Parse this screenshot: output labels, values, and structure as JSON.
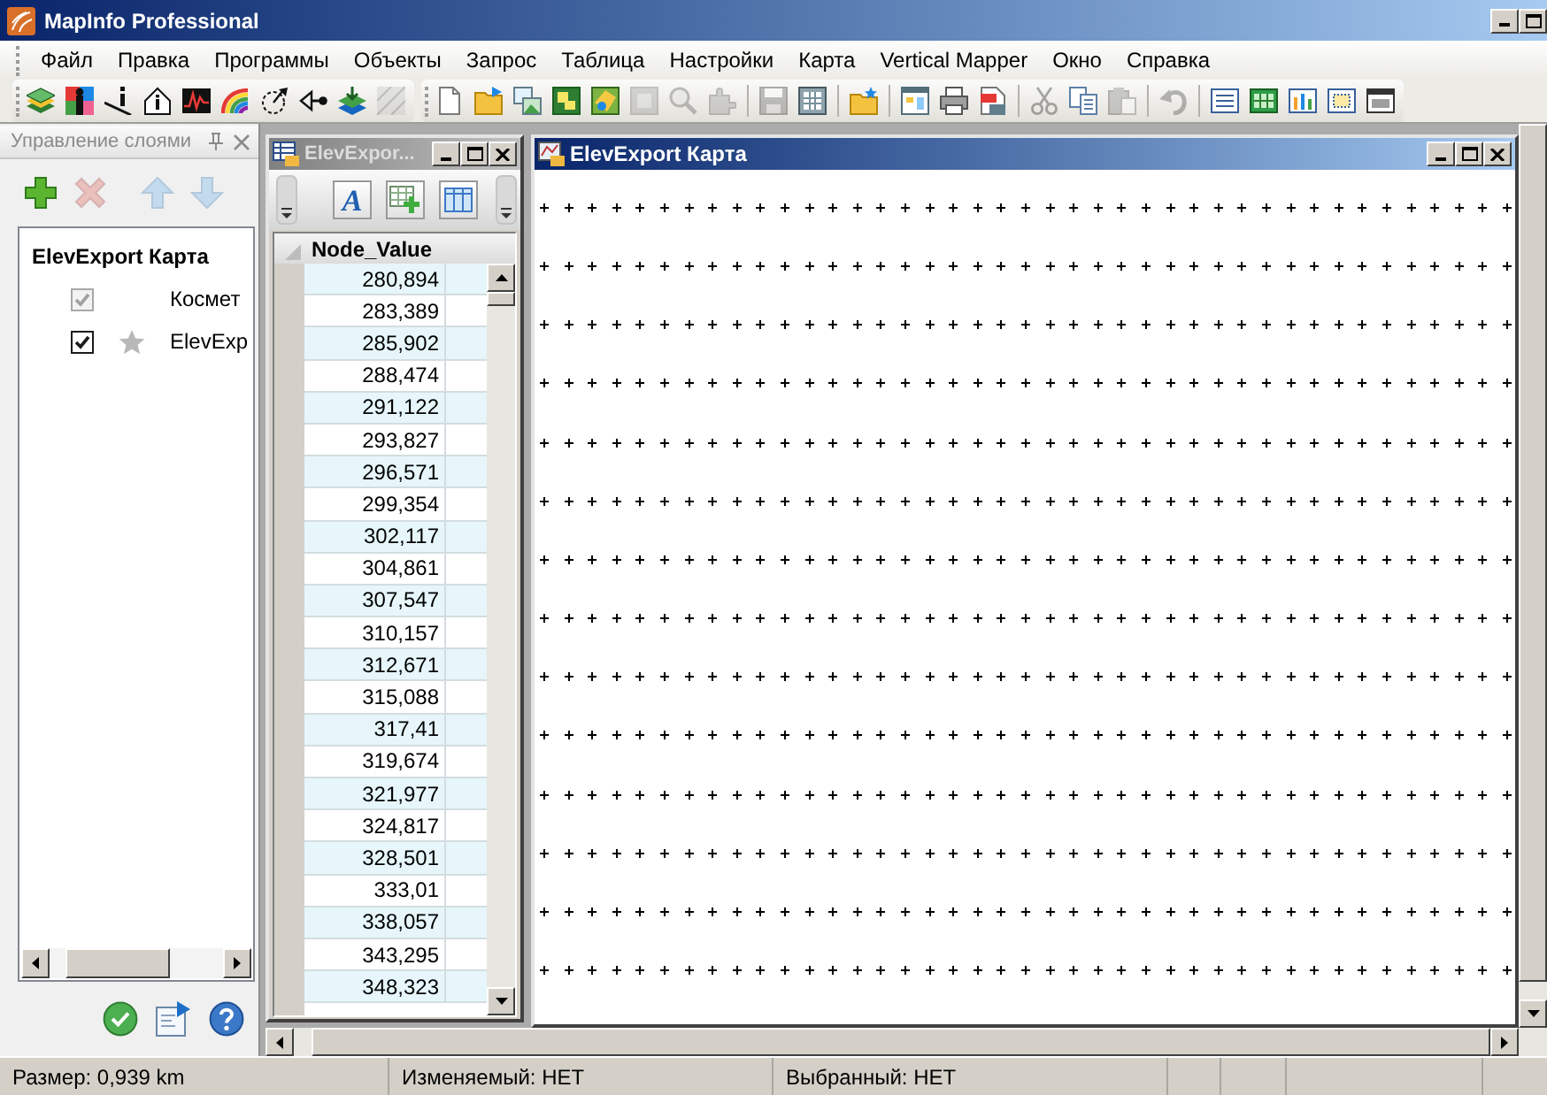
{
  "window": {
    "title": "MapInfo Professional"
  },
  "menu": [
    "Файл",
    "Правка",
    "Программы",
    "Объекты",
    "Запрос",
    "Таблица",
    "Настройки",
    "Карта",
    "Vertical Mapper",
    "Окно",
    "Справка"
  ],
  "toolbars": [
    {
      "groups": [
        [
          {
            "kind": "layers",
            "disabled": false
          },
          {
            "kind": "palette",
            "disabled": false
          },
          {
            "kind": "lineinfo",
            "disabled": false
          },
          {
            "kind": "houseinfo",
            "disabled": false
          },
          {
            "kind": "graph",
            "disabled": false
          },
          {
            "kind": "rainbow",
            "disabled": false
          },
          {
            "kind": "rotate",
            "disabled": false
          },
          {
            "kind": "arrow",
            "disabled": false
          },
          {
            "kind": "stack",
            "disabled": false
          },
          {
            "kind": "hatch",
            "disabled": true
          }
        ]
      ]
    },
    {
      "groups": [
        [
          {
            "kind": "new",
            "disabled": false
          },
          {
            "kind": "open",
            "disabled": false
          },
          {
            "kind": "workspace",
            "disabled": false
          },
          {
            "kind": "map",
            "disabled": false
          },
          {
            "kind": "browse",
            "disabled": false
          },
          {
            "kind": "mapgrey",
            "disabled": true
          },
          {
            "kind": "search",
            "disabled": true
          },
          {
            "kind": "tool",
            "disabled": true
          }
        ],
        [
          {
            "kind": "save",
            "disabled": true
          },
          {
            "kind": "saveas",
            "disabled": false
          }
        ],
        [
          {
            "kind": "folder",
            "disabled": false
          }
        ],
        [
          {
            "kind": "export",
            "disabled": false
          },
          {
            "kind": "print",
            "disabled": false
          },
          {
            "kind": "pdf",
            "disabled": false
          }
        ],
        [
          {
            "kind": "cut",
            "disabled": true
          },
          {
            "kind": "copy",
            "disabled": false
          },
          {
            "kind": "paste",
            "disabled": true
          }
        ],
        [
          {
            "kind": "undo",
            "disabled": true
          }
        ],
        [
          {
            "kind": "list",
            "disabled": false
          },
          {
            "kind": "grid",
            "disabled": false
          },
          {
            "kind": "bars",
            "disabled": false
          },
          {
            "kind": "layout",
            "disabled": false
          },
          {
            "kind": "window",
            "disabled": false
          }
        ]
      ]
    }
  ],
  "layer_panel": {
    "title": "Управление слоями",
    "button_groups": [
      [
        {
          "kind": "add",
          "disabled": false
        },
        {
          "kind": "remove",
          "disabled": true
        }
      ],
      [
        {
          "kind": "up",
          "disabled": true
        },
        {
          "kind": "down",
          "disabled": true
        }
      ]
    ],
    "map": "ElevExport Карта",
    "layers": [
      {
        "kind": "cosmetic",
        "name": "Космет",
        "checked": true,
        "disabled": true
      },
      {
        "kind": "points",
        "name": "ElevExp",
        "checked": true,
        "disabled": false
      }
    ],
    "footer_buttons": [
      {
        "kind": "apply"
      },
      {
        "kind": "export"
      },
      {
        "kind": "help"
      }
    ]
  },
  "table_window": {
    "title": "ElevExpor...",
    "active": false,
    "tools": [
      {
        "kind": "font",
        "label": "A"
      },
      {
        "kind": "addcolumn"
      },
      {
        "kind": "columns"
      }
    ],
    "columns": [
      "Node_Value"
    ],
    "rows": [
      "280,894",
      "283,389",
      "285,902",
      "288,474",
      "291,122",
      "293,827",
      "296,571",
      "299,354",
      "302,117",
      "304,861",
      "307,547",
      "310,157",
      "312,671",
      "315,088",
      "317,41",
      "319,674",
      "321,977",
      "324,817",
      "328,501",
      "333,01",
      "338,057",
      "343,295",
      "348,323"
    ]
  },
  "map_window": {
    "title": "ElevExport Карта",
    "active": true
  },
  "status_bar": [
    "Размер: 0,939 km",
    "Изменяемый: НЕТ",
    "Выбранный: НЕТ"
  ]
}
